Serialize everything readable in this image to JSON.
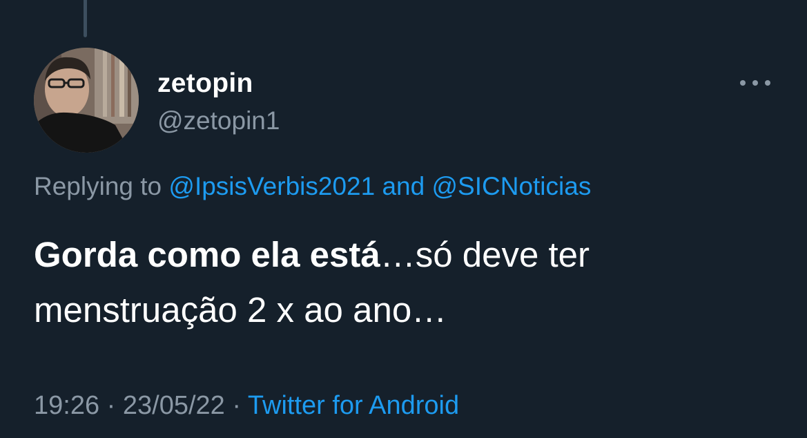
{
  "tweet": {
    "author": {
      "display_name": "zetopin",
      "handle": "@zetopin1",
      "avatar": "avatar-photo"
    },
    "more_icon": "more-horizontal-icon",
    "replying": {
      "prefix": "Replying to",
      "mention_1": "@IpsisVerbis2021",
      "conjunction": "and",
      "mention_2": "@SICNoticias"
    },
    "text": {
      "bold_part": "Gorda como ela está",
      "rest_line1": "…só deve ter",
      "line2": "menstruação 2 x ao ano…"
    },
    "meta": {
      "time": "19:26",
      "separator": "·",
      "date": "23/05/22",
      "source": "Twitter for Android"
    }
  },
  "colors": {
    "background": "#15202b",
    "primary_text": "#ffffff",
    "secondary_text": "#8b98a5",
    "link": "#1d9bf0"
  }
}
